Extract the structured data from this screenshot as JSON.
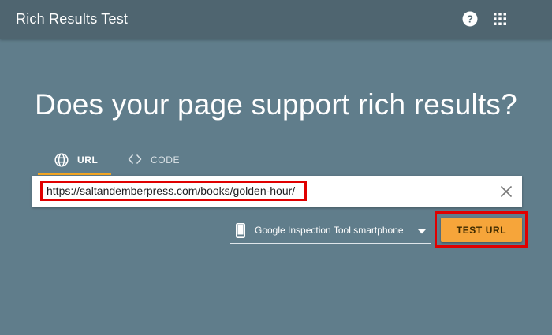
{
  "header": {
    "title": "Rich Results Test",
    "help_icon": "help-circle-icon",
    "apps_icon": "apps-grid-icon"
  },
  "main": {
    "headline": "Does your page support rich results?",
    "tabs": [
      {
        "label": "URL",
        "icon": "globe-icon",
        "selected": true
      },
      {
        "label": "CODE",
        "icon": "code-brackets-icon",
        "selected": false
      }
    ],
    "url_input": {
      "value": "https://saltandemberpress.com/books/golden-hour/",
      "clear_icon": "close-icon"
    },
    "device_select": {
      "selected": "Google Inspection Tool smartphone",
      "icon": "smartphone-icon"
    },
    "test_button_label": "TEST URL"
  },
  "colors": {
    "background": "#607d8b",
    "header": "#4f6570",
    "accent": "#f5a623",
    "highlight_box": "#e00000"
  }
}
